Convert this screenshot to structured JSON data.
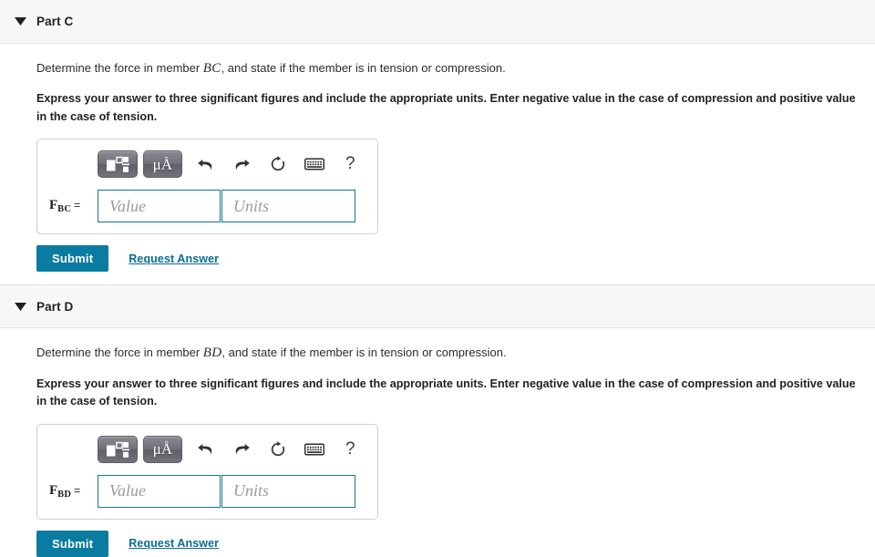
{
  "parts": [
    {
      "id": "part-c",
      "title": "Part C",
      "caret_icon": "caret-down-icon",
      "prompt_before": "Determine the force in member ",
      "prompt_math": "BC",
      "prompt_after": ", and state if the member is in tension or compression.",
      "instruction": "Express your answer to three significant figures and include the appropriate units. Enter negative value in the case of compression and positive value in the case of tension.",
      "toolbar": {
        "template_button": "math-template-icon",
        "units_button": "μÅ",
        "undo": "undo-icon",
        "redo": "redo-icon",
        "reset": "reset-icon",
        "keyboard": "keyboard-icon",
        "help": "?"
      },
      "entry": {
        "variable_base": "F",
        "variable_sub": "BC",
        "equals": "=",
        "value_placeholder": "Value",
        "units_placeholder": "Units",
        "value_current": "",
        "units_current": ""
      },
      "submit_label": "Submit",
      "request_answer_label": "Request Answer"
    },
    {
      "id": "part-d",
      "title": "Part D",
      "caret_icon": "caret-down-icon",
      "prompt_before": "Determine the force in member ",
      "prompt_math": "BD",
      "prompt_after": ", and state if the member is in tension or compression.",
      "instruction": "Express your answer to three significant figures and include the appropriate units. Enter negative value in the case of compression and positive value in the case of tension.",
      "toolbar": {
        "template_button": "math-template-icon",
        "units_button": "μÅ",
        "undo": "undo-icon",
        "redo": "redo-icon",
        "reset": "reset-icon",
        "keyboard": "keyboard-icon",
        "help": "?"
      },
      "entry": {
        "variable_base": "F",
        "variable_sub": "BD",
        "equals": "=",
        "value_placeholder": "Value",
        "units_placeholder": "Units",
        "value_current": "",
        "units_current": ""
      },
      "submit_label": "Submit",
      "request_answer_label": "Request Answer"
    }
  ],
  "colors": {
    "accent": "#0a7ca1",
    "link": "#0a6d95",
    "field_border": "#13788f",
    "header_bg": "#f7f7f7",
    "toolbar_button": "#6f6f78"
  }
}
